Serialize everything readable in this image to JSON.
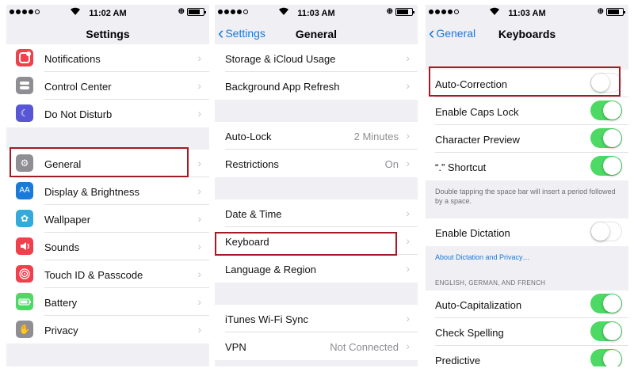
{
  "colors": {
    "notifications": "#f0404b",
    "control_center": "#8e8e93",
    "do_not_disturb": "#5856d6",
    "general": "#8e8e93",
    "display": "#1a7ad7",
    "wallpaper": "#34aadc",
    "sounds": "#f0404b",
    "touch_id": "#f0404b",
    "battery": "#4cd964",
    "privacy": "#8e8e93",
    "link": "#1a7ad7",
    "highlight": "#a21b23"
  },
  "settings": {
    "status": {
      "time": "11:02 AM"
    },
    "nav": {
      "title": "Settings"
    },
    "items": [
      {
        "label": "Notifications",
        "icon": "notifications-icon"
      },
      {
        "label": "Control Center",
        "icon": "control-center-icon"
      },
      {
        "label": "Do Not Disturb",
        "icon": "moon-icon"
      },
      {
        "label": "General",
        "icon": "gear-icon"
      },
      {
        "label": "Display & Brightness",
        "icon": "display-icon",
        "glyph": "AA"
      },
      {
        "label": "Wallpaper",
        "icon": "wallpaper-icon"
      },
      {
        "label": "Sounds",
        "icon": "speaker-icon"
      },
      {
        "label": "Touch ID & Passcode",
        "icon": "fingerprint-icon"
      },
      {
        "label": "Battery",
        "icon": "battery-icon"
      },
      {
        "label": "Privacy",
        "icon": "hand-icon"
      }
    ]
  },
  "general": {
    "status": {
      "time": "11:03 AM"
    },
    "nav": {
      "back": "Settings",
      "title": "General"
    },
    "items": [
      {
        "label": "Storage & iCloud Usage"
      },
      {
        "label": "Background App Refresh"
      },
      {
        "label": "Auto-Lock",
        "value": "2 Minutes"
      },
      {
        "label": "Restrictions",
        "value": "On"
      },
      {
        "label": "Date & Time"
      },
      {
        "label": "Keyboard"
      },
      {
        "label": "Language & Region"
      },
      {
        "label": "iTunes Wi-Fi Sync"
      },
      {
        "label": "VPN",
        "value": "Not Connected"
      }
    ]
  },
  "keyboards": {
    "status": {
      "time": "11:03 AM"
    },
    "nav": {
      "back": "General",
      "title": "Keyboards"
    },
    "items": [
      {
        "label": "Auto-Correction",
        "on": false
      },
      {
        "label": "Enable Caps Lock",
        "on": true
      },
      {
        "label": "Character Preview",
        "on": true
      },
      {
        "label": "“.” Shortcut",
        "on": true
      },
      {
        "label": "Enable Dictation",
        "on": false
      },
      {
        "label": "Auto-Capitalization",
        "on": true
      },
      {
        "label": "Check Spelling",
        "on": true
      },
      {
        "label": "Predictive",
        "on": true
      }
    ],
    "shortcut_note": "Double tapping the space bar will insert a period followed by a space.",
    "dictation_link": "About Dictation and Privacy…",
    "language_header": "ENGLISH, GERMAN, AND FRENCH"
  }
}
